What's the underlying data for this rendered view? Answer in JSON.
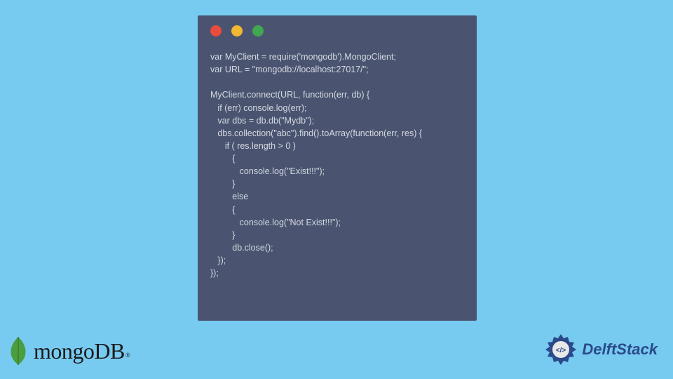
{
  "code": {
    "lines": "var MyClient = require('mongodb').MongoClient;\nvar URL = \"mongodb://localhost:27017/\";\n\nMyClient.connect(URL, function(err, db) {\n   if (err) console.log(err);\n   var dbs = db.db(\"Mydb\");\n   dbs.collection(\"abc\").find().toArray(function(err, res) {\n      if ( res.length > 0 )\n         {\n            console.log(\"Exist!!!\");\n         }\n         else\n         {\n            console.log(\"Not Exist!!!\");\n         }\n         db.close();\n   });\n});"
  },
  "mongodb": {
    "name": "mongo",
    "suffix": "DB",
    "trademark": "®"
  },
  "delftstack": {
    "name": "DelftStack"
  }
}
